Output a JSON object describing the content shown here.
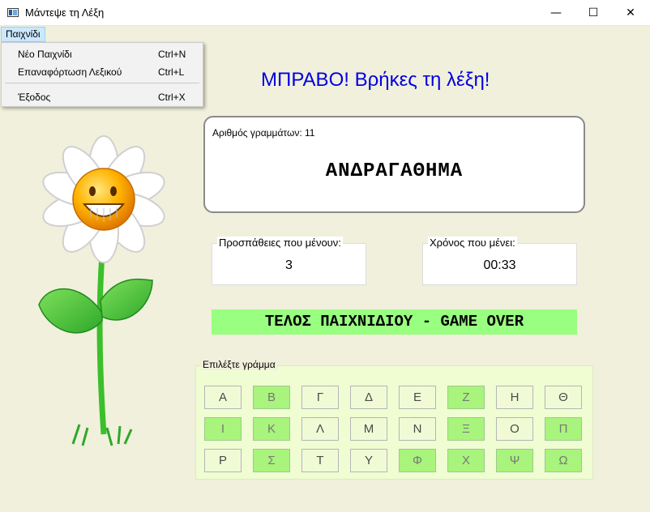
{
  "window": {
    "title": "Μάντεψε τη Λέξη",
    "minimize_glyph": "—",
    "maximize_glyph": "☐",
    "close_glyph": "✕"
  },
  "menu": {
    "root": "Παιχνίδι",
    "items": [
      {
        "label": "Νέο Παιχνίδι",
        "shortcut": "Ctrl+N"
      },
      {
        "label": "Επαναφόρτωση Λεξικού",
        "shortcut": "Ctrl+L"
      },
      {
        "label": "Έξοδος",
        "shortcut": "Ctrl+X"
      }
    ]
  },
  "success_message": "ΜΠΡΑΒΟ! Βρήκες τη λέξη!",
  "word_panel": {
    "letters_count": "Αριθμός γραμμάτων: 11",
    "word": "ΑΝΔΡΑΓΑΘΗΜΑ"
  },
  "attempts": {
    "legend": "Προσπάθειες που μένουν:",
    "value": "3"
  },
  "timer": {
    "legend": "Χρόνος που μένει:",
    "value": "00:33"
  },
  "game_over": "ΤΕΛΟΣ ΠΑΙΧΝΙΔΙΟΥ - GAME OVER",
  "keyboard": {
    "legend": "Επιλέξτε γράμμα",
    "keys": [
      {
        "letter": "Α",
        "used": false
      },
      {
        "letter": "Β",
        "used": true
      },
      {
        "letter": "Γ",
        "used": false
      },
      {
        "letter": "Δ",
        "used": false
      },
      {
        "letter": "Ε",
        "used": false
      },
      {
        "letter": "Ζ",
        "used": true
      },
      {
        "letter": "Η",
        "used": false
      },
      {
        "letter": "Θ",
        "used": false
      },
      {
        "letter": "Ι",
        "used": true
      },
      {
        "letter": "Κ",
        "used": true
      },
      {
        "letter": "Λ",
        "used": false
      },
      {
        "letter": "Μ",
        "used": false
      },
      {
        "letter": "Ν",
        "used": false
      },
      {
        "letter": "Ξ",
        "used": true
      },
      {
        "letter": "Ο",
        "used": false
      },
      {
        "letter": "Π",
        "used": true
      },
      {
        "letter": "Ρ",
        "used": false
      },
      {
        "letter": "Σ",
        "used": true
      },
      {
        "letter": "Τ",
        "used": false
      },
      {
        "letter": "Υ",
        "used": false
      },
      {
        "letter": "Φ",
        "used": true
      },
      {
        "letter": "Χ",
        "used": true
      },
      {
        "letter": "Ψ",
        "used": true
      },
      {
        "letter": "Ω",
        "used": true
      }
    ]
  },
  "colors": {
    "background": "#f1f0dc",
    "success_text": "#0000e0",
    "game_over_bg": "#99ff80",
    "used_key": "#a8f47c",
    "unused_key": "#f0fbd6",
    "keyboard_bg": "#f0fcd2"
  },
  "icons": {
    "app": "app-window-icon",
    "mascot": "smiling-daisy-flower"
  }
}
